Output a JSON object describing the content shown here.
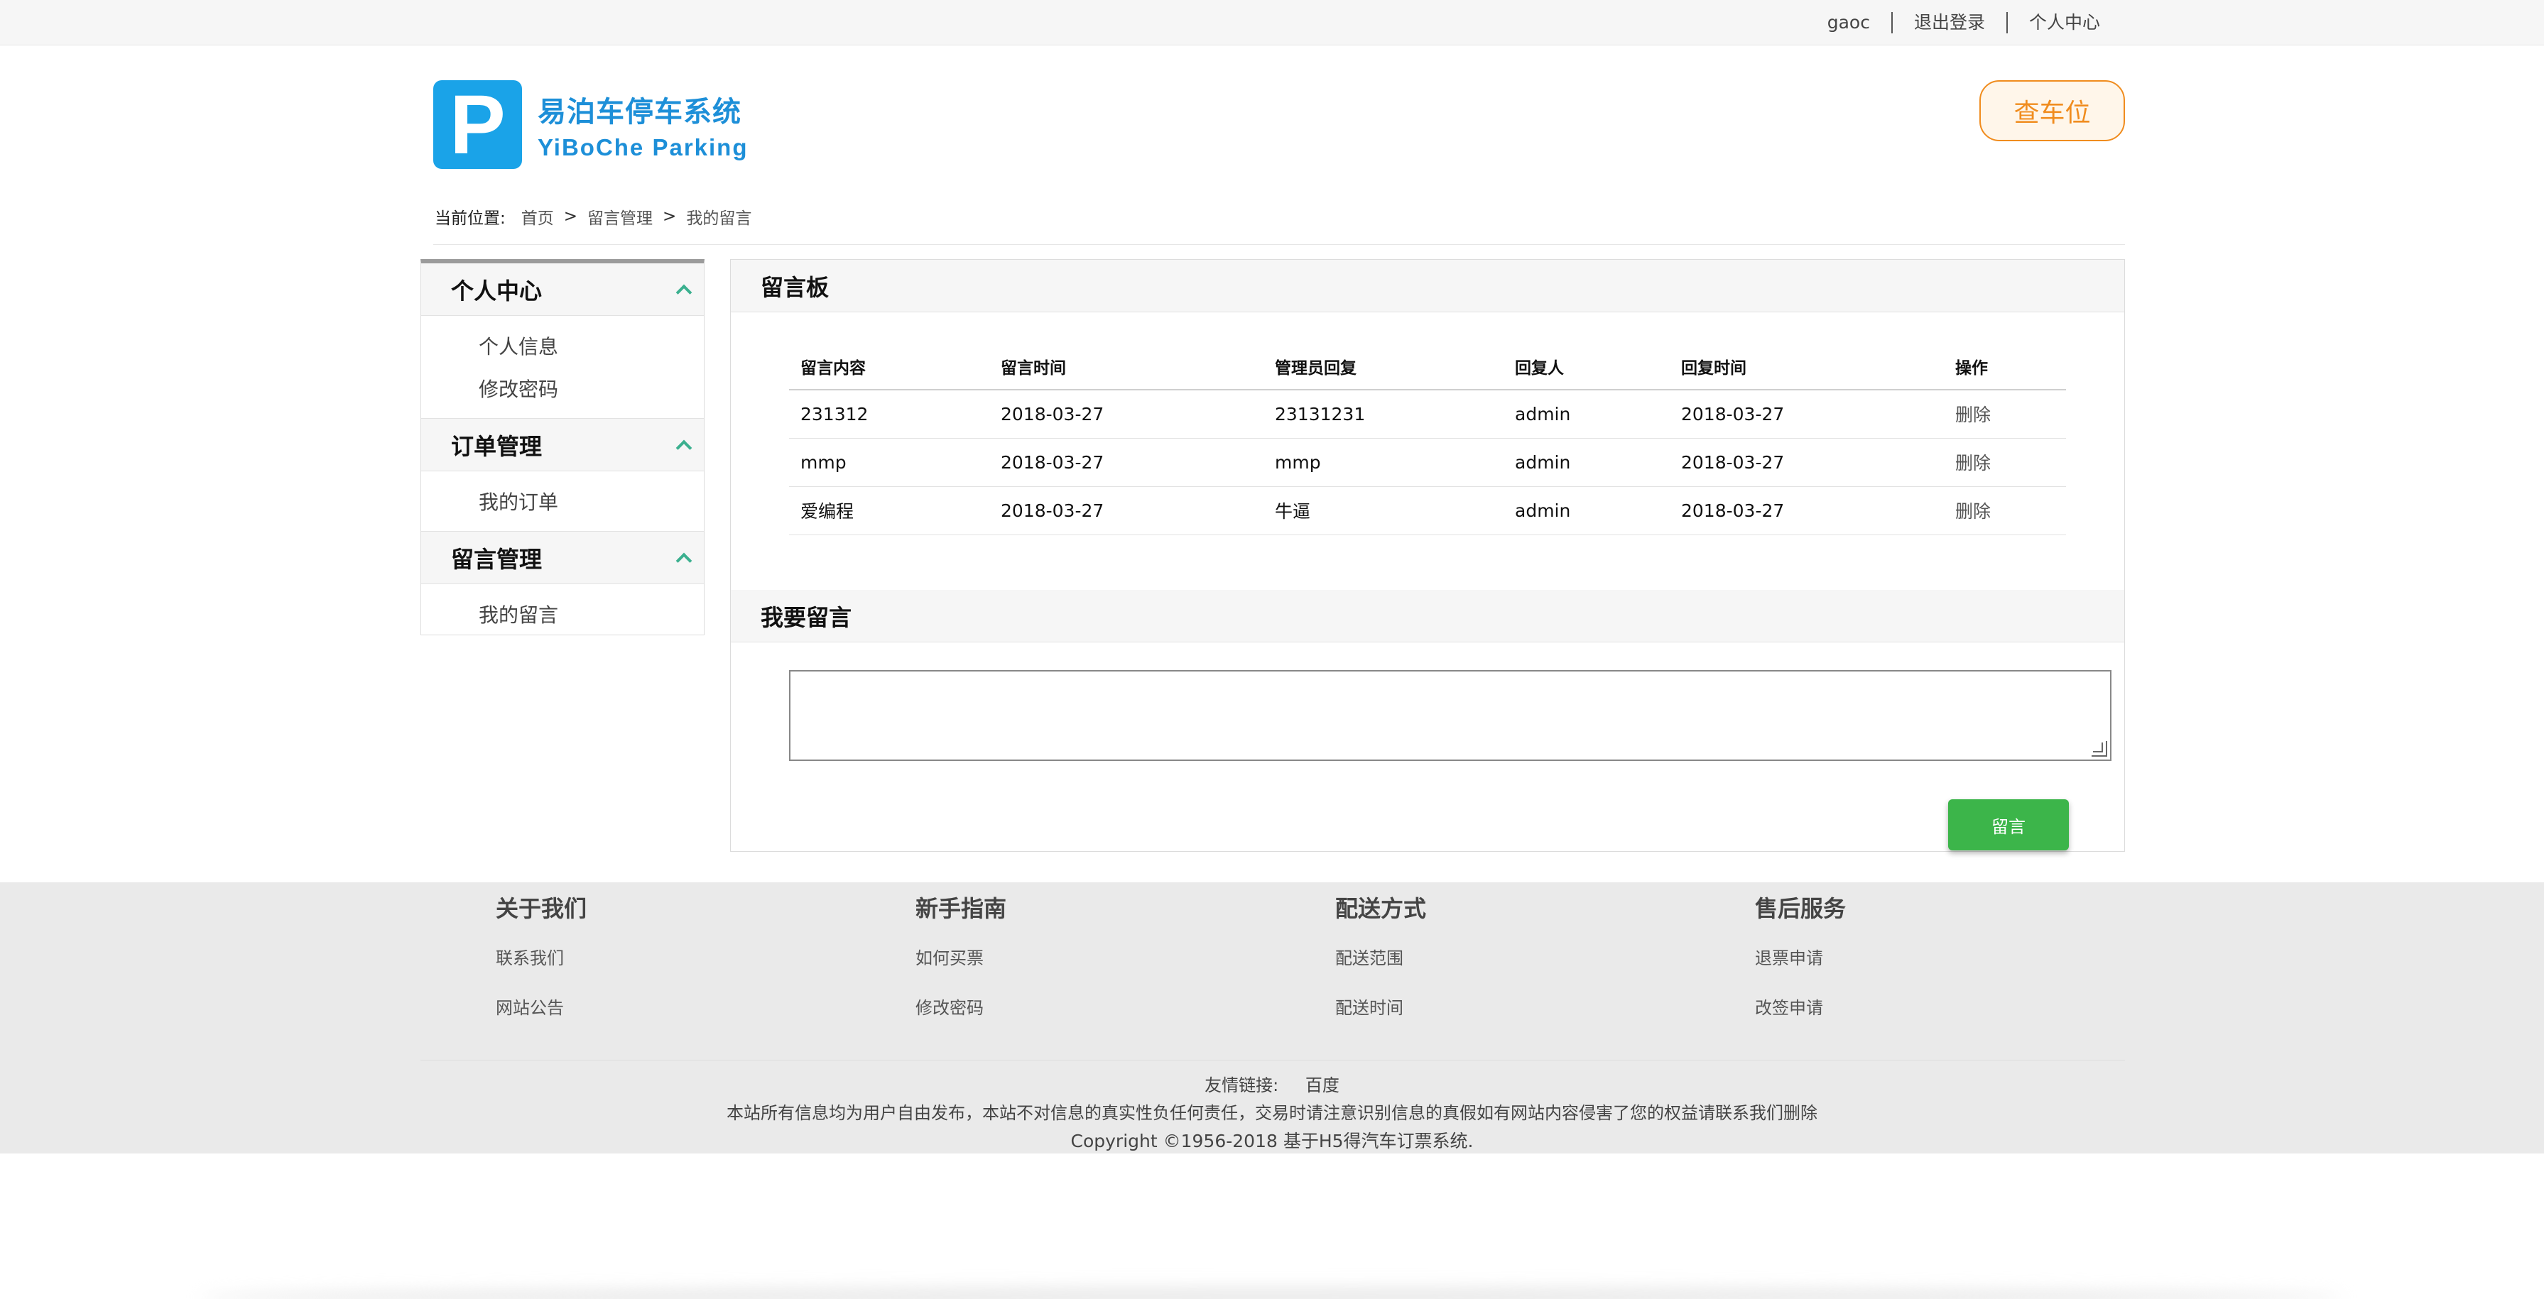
{
  "topbar": {
    "username": "gaoc",
    "logout": "退出登录",
    "user_center": "个人中心"
  },
  "header": {
    "logo_glyph": "P",
    "logo_cn": "易泊车停车系统",
    "logo_en": "YiBoChe  Parking",
    "check_button": "查车位",
    "accent_color": "#1aa3e8",
    "button_color": "#f08c1e"
  },
  "breadcrumb": {
    "label": "当前位置:",
    "items": [
      "首页",
      "留言管理",
      "我的留言"
    ],
    "separator": ">"
  },
  "sidebar": {
    "sections": [
      {
        "title": "个人中心",
        "items": [
          "个人信息",
          "修改密码"
        ]
      },
      {
        "title": "订单管理",
        "items": [
          "我的订单"
        ]
      },
      {
        "title": "留言管理",
        "items": [
          "我的留言"
        ]
      }
    ],
    "chevron_icon": "chevron-up-icon"
  },
  "board": {
    "title": "留言板",
    "columns": [
      "留言内容",
      "留言时间",
      "管理员回复",
      "回复人",
      "回复时间",
      "操作"
    ],
    "rows": [
      [
        "231312",
        "2018-03-27",
        "23131231",
        "admin",
        "2018-03-27",
        "删除"
      ],
      [
        "mmp",
        "2018-03-27",
        "mmp",
        "admin",
        "2018-03-27",
        "删除"
      ],
      [
        "爱编程",
        "2018-03-27",
        "牛逼",
        "admin",
        "2018-03-27",
        "删除"
      ]
    ]
  },
  "compose": {
    "title": "我要留言",
    "textarea_value": "",
    "submit_label": "留言",
    "submit_color": "#3cb54a"
  },
  "footer": {
    "columns": [
      {
        "title": "关于我们",
        "links": [
          "联系我们",
          "网站公告"
        ]
      },
      {
        "title": "新手指南",
        "links": [
          "如何买票",
          "修改密码"
        ]
      },
      {
        "title": "配送方式",
        "links": [
          "配送范围",
          "配送时间"
        ]
      },
      {
        "title": "售后服务",
        "links": [
          "退票申请",
          "改签申请"
        ]
      }
    ],
    "friend_label": "友情链接:",
    "friend_link": "百度",
    "disclaimer": "本站所有信息均为用户自由发布，本站不对信息的真实性负任何责任，交易时请注意识别信息的真假如有网站内容侵害了您的权益请联系我们删除",
    "copyright": "Copyright ©1956-2018 基于H5得汽车订票系统."
  }
}
